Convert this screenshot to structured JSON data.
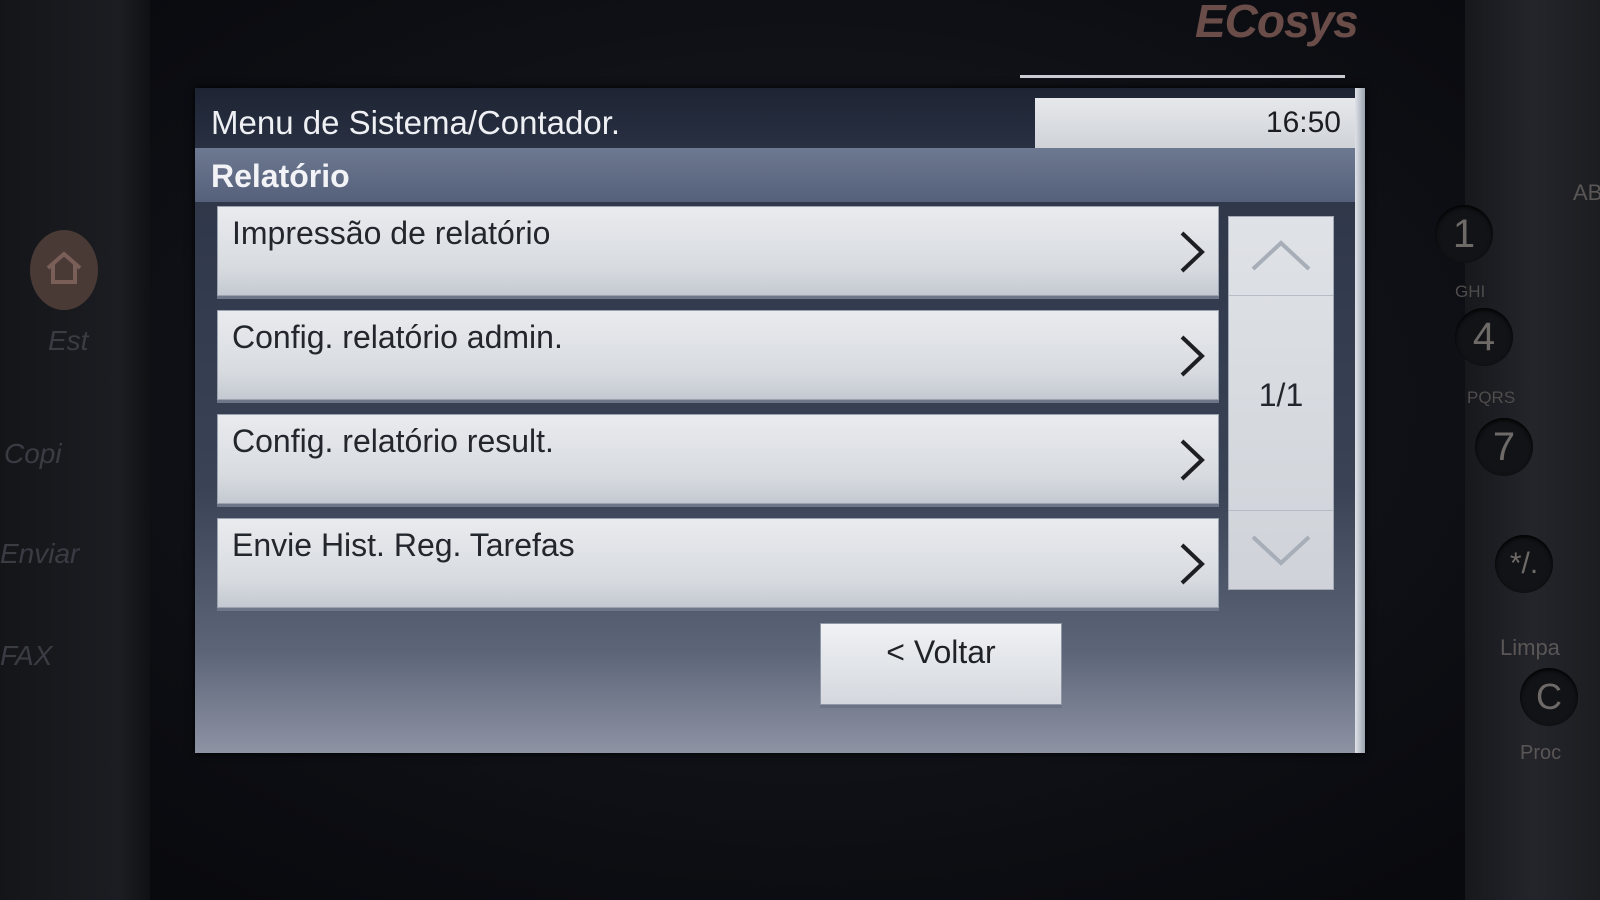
{
  "device": {
    "brand": "ECosys",
    "left_labels": [
      "Est",
      "Copi",
      "Enviar",
      "FAX"
    ],
    "keypad": [
      {
        "key": "1",
        "letters": ""
      },
      {
        "key": "4",
        "letters": "GHI"
      },
      {
        "key": "7",
        "letters": "PQRS"
      },
      {
        "key": "*/.",
        "letters": ""
      }
    ],
    "right_labels": {
      "clear": "Limpa",
      "proc": "Proc",
      "abc": "AB"
    }
  },
  "header": {
    "title": "Menu de Sistema/Contador.",
    "time": "16:50"
  },
  "section": {
    "title": "Relatório"
  },
  "menu": {
    "items": [
      {
        "label": "Impressão de relatório"
      },
      {
        "label": "Config. relatório admin."
      },
      {
        "label": "Config. relatório result."
      },
      {
        "label": "Envie Hist. Reg. Tarefas"
      }
    ]
  },
  "pager": {
    "indicator": "1/1"
  },
  "footer": {
    "back_label": "< Voltar"
  },
  "colors": {
    "title_bar": "#1e2433",
    "section_bar": "#5f6a84",
    "item_bg": "#dfe2e6",
    "clock_bg": "#e0e3e6"
  }
}
